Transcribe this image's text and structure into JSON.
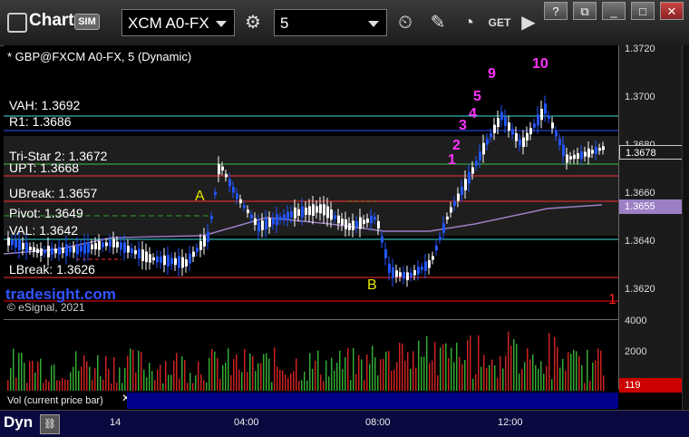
{
  "app": {
    "title": "Chart",
    "sim_badge": "SIM"
  },
  "toolbar": {
    "symbol": "XCM A0-FX",
    "interval": "5",
    "get_label": "GET"
  },
  "chart": {
    "series_title": "* GBP@FXCM A0-FX, 5 (Dynamic)",
    "watermark": "tradesight.com",
    "copyright": "© eSignal, 2021",
    "levels": [
      {
        "label": "VAH: 1.3692",
        "color": "#40e0e0"
      },
      {
        "label": "R1: 1.3686",
        "color": "#3050ff"
      },
      {
        "label": "Tri-Star 2: 1.3672",
        "color": "#40c040"
      },
      {
        "label": "UPT: 1.3668",
        "color": "#ff3030"
      },
      {
        "label": "UBreak: 1.3657",
        "color": "#ff3030"
      },
      {
        "label": "Pivot: 1.3649",
        "color": "#30a030"
      },
      {
        "label": "VAL: 1.3642",
        "color": "#40e0e0"
      },
      {
        "label": "LBreak: 1.3626",
        "color": "#ff3030"
      }
    ],
    "annotations": {
      "A": "A",
      "B": "B",
      "ten": "10",
      "nine": "9",
      "five": "5",
      "four": "4",
      "three": "3",
      "two": "2",
      "one": "1",
      "red_one": "1"
    },
    "price_ticks": [
      "1.3720",
      "1.3700",
      "1.3680",
      "1.3660",
      "1.3640",
      "1.3620"
    ],
    "current_price": "1.3678",
    "ma_price": "1.3655"
  },
  "volume": {
    "label": "Vol (current price bar)",
    "ticks": [
      "4000",
      "2000"
    ],
    "current": "119"
  },
  "time_axis": {
    "day": "14",
    "ticks": [
      "04:00",
      "08:00",
      "12:00"
    ]
  },
  "bottom": {
    "dyn": "Dyn"
  },
  "colors": {
    "up": "#ffffff",
    "down": "#2255ff",
    "vol_up": "#33aa33",
    "vol_down": "#cc2222"
  }
}
